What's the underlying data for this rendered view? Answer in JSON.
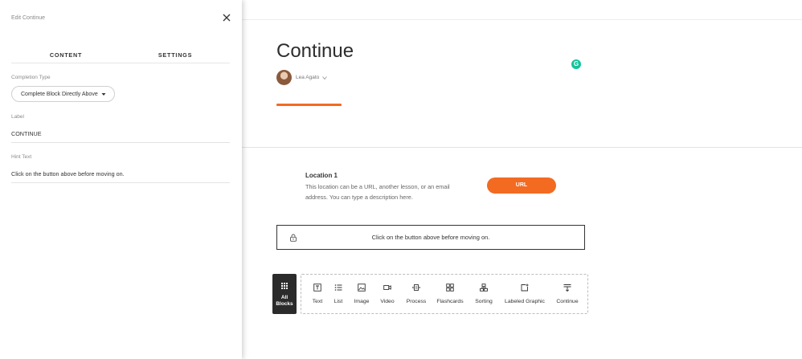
{
  "panel": {
    "title": "Edit Continue",
    "tabs": [
      {
        "label": "CONTENT",
        "active": true
      },
      {
        "label": "SETTINGS",
        "active": false
      }
    ],
    "completion_type": {
      "label": "Completion Type",
      "value": "Complete Block Directly Above"
    },
    "label_field": {
      "label": "Label",
      "value": "CONTINUE"
    },
    "hint_field": {
      "label": "Hint Text",
      "value": "Click on the button above before moving on."
    }
  },
  "lesson": {
    "title": "Continue",
    "author": "Lea Agato",
    "accent_color": "#f26b21"
  },
  "location": {
    "title": "Location 1",
    "description": "This location can be a URL, another lesson, or an email address. You can type a description here.",
    "button_label": "URL"
  },
  "continue_block": {
    "hint": "Click on the button above before moving on."
  },
  "toolbar": {
    "all_blocks_label": "All Blocks",
    "items": [
      {
        "label": "Text",
        "icon": "text-block-icon"
      },
      {
        "label": "List",
        "icon": "list-icon"
      },
      {
        "label": "Image",
        "icon": "image-icon"
      },
      {
        "label": "Video",
        "icon": "video-icon"
      },
      {
        "label": "Process",
        "icon": "process-icon"
      },
      {
        "label": "Flashcards",
        "icon": "flashcards-icon"
      },
      {
        "label": "Sorting",
        "icon": "sorting-icon"
      },
      {
        "label": "Labeled Graphic",
        "icon": "labeled-graphic-icon"
      },
      {
        "label": "Continue",
        "icon": "continue-icon"
      }
    ]
  },
  "colors": {
    "accent": "#f26b21",
    "dark": "#2b2b2b",
    "grammarly": "#15c39a"
  }
}
